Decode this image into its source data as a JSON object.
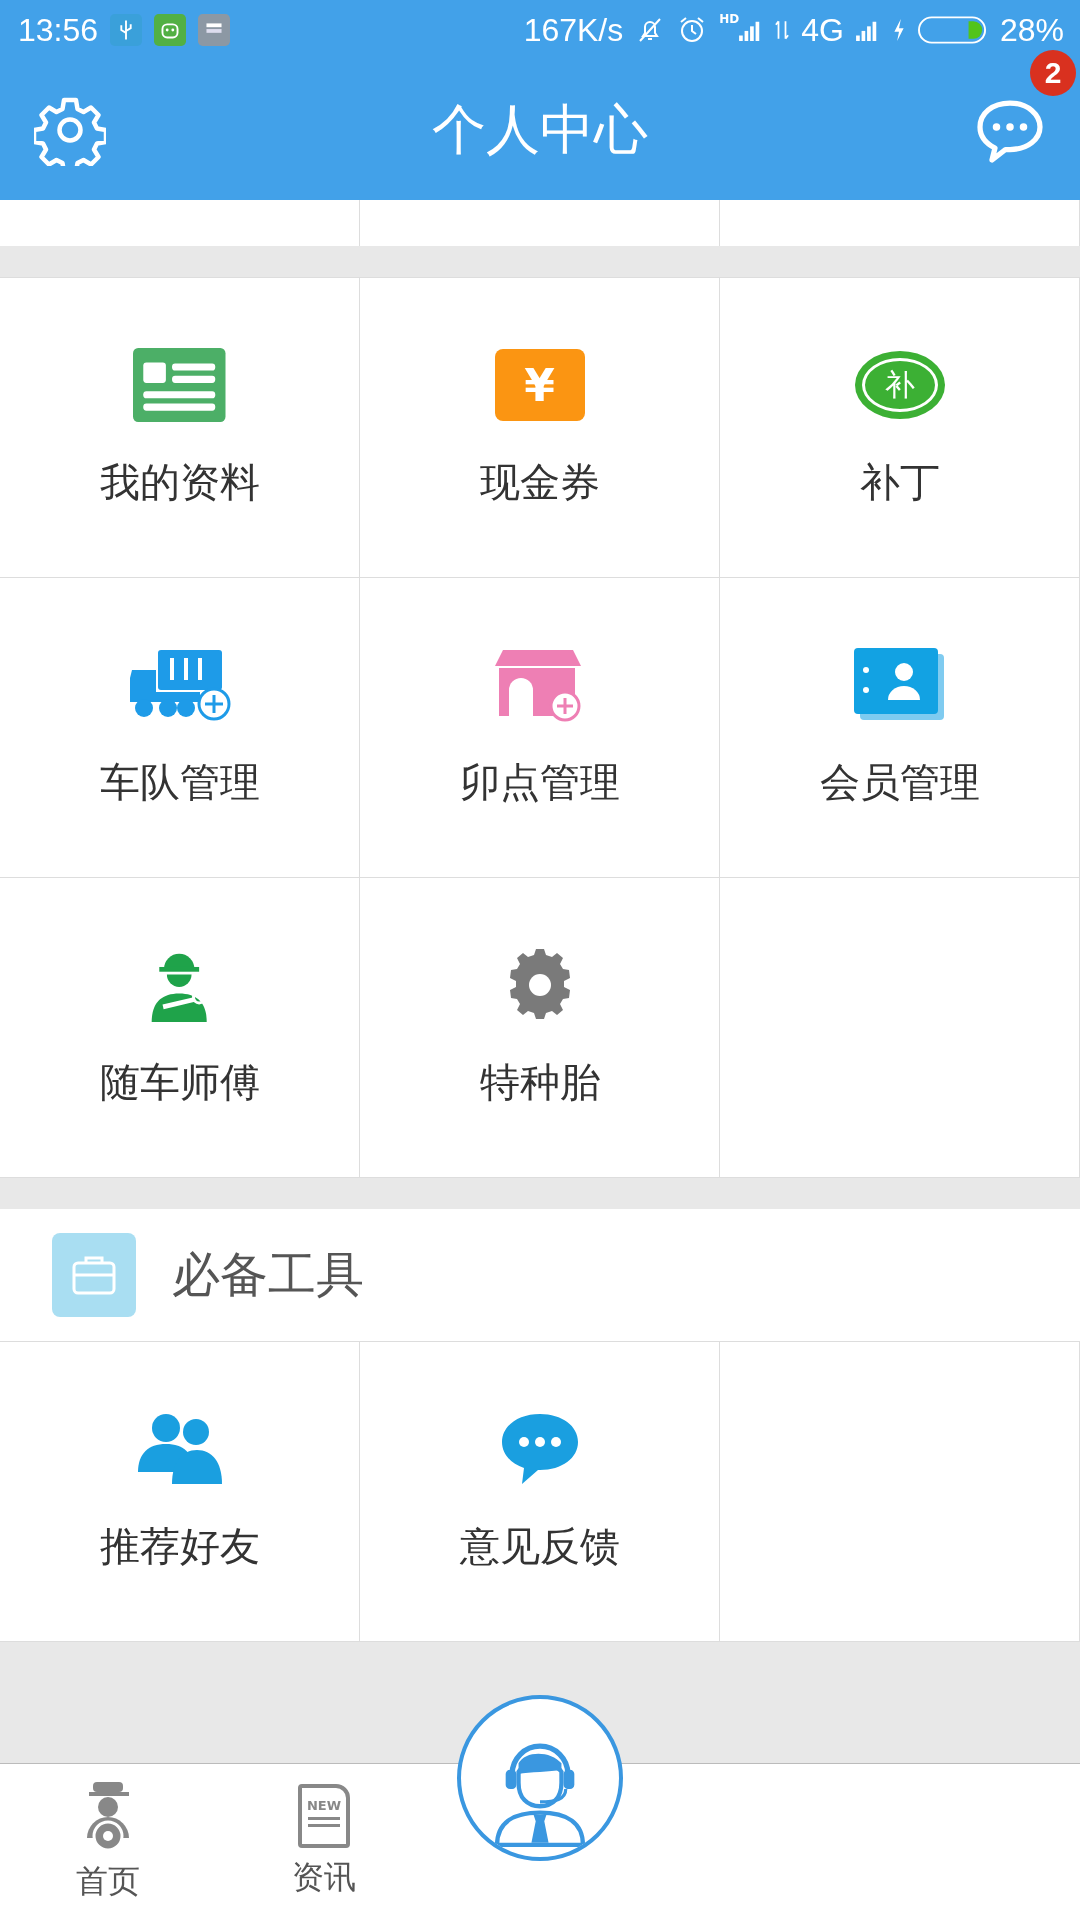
{
  "status_bar": {
    "time": "13:56",
    "speed": "167K/s",
    "hd": "HD",
    "network": "4G",
    "battery": "28%"
  },
  "header": {
    "title": "个人中心",
    "badge": "2"
  },
  "grid": [
    {
      "kind": "profile",
      "label": "我的资料"
    },
    {
      "kind": "coupon",
      "label": "现金券",
      "icon_text": "¥"
    },
    {
      "kind": "patch",
      "label": "补丁",
      "icon_text": "补"
    },
    {
      "kind": "fleet",
      "label": "车队管理"
    },
    {
      "kind": "shop",
      "label": "卯点管理"
    },
    {
      "kind": "member",
      "label": "会员管理"
    },
    {
      "kind": "mechanic",
      "label": "随车师傅"
    },
    {
      "kind": "tire",
      "label": "特种胎"
    }
  ],
  "tools": {
    "title": "必备工具",
    "items": [
      {
        "kind": "friends",
        "label": "推荐好友"
      },
      {
        "kind": "feedback",
        "label": "意见反馈"
      }
    ]
  },
  "bottom_nav": [
    {
      "kind": "home",
      "label": "首页"
    },
    {
      "kind": "news",
      "label": "资讯",
      "icon_text": "NEW"
    }
  ]
}
